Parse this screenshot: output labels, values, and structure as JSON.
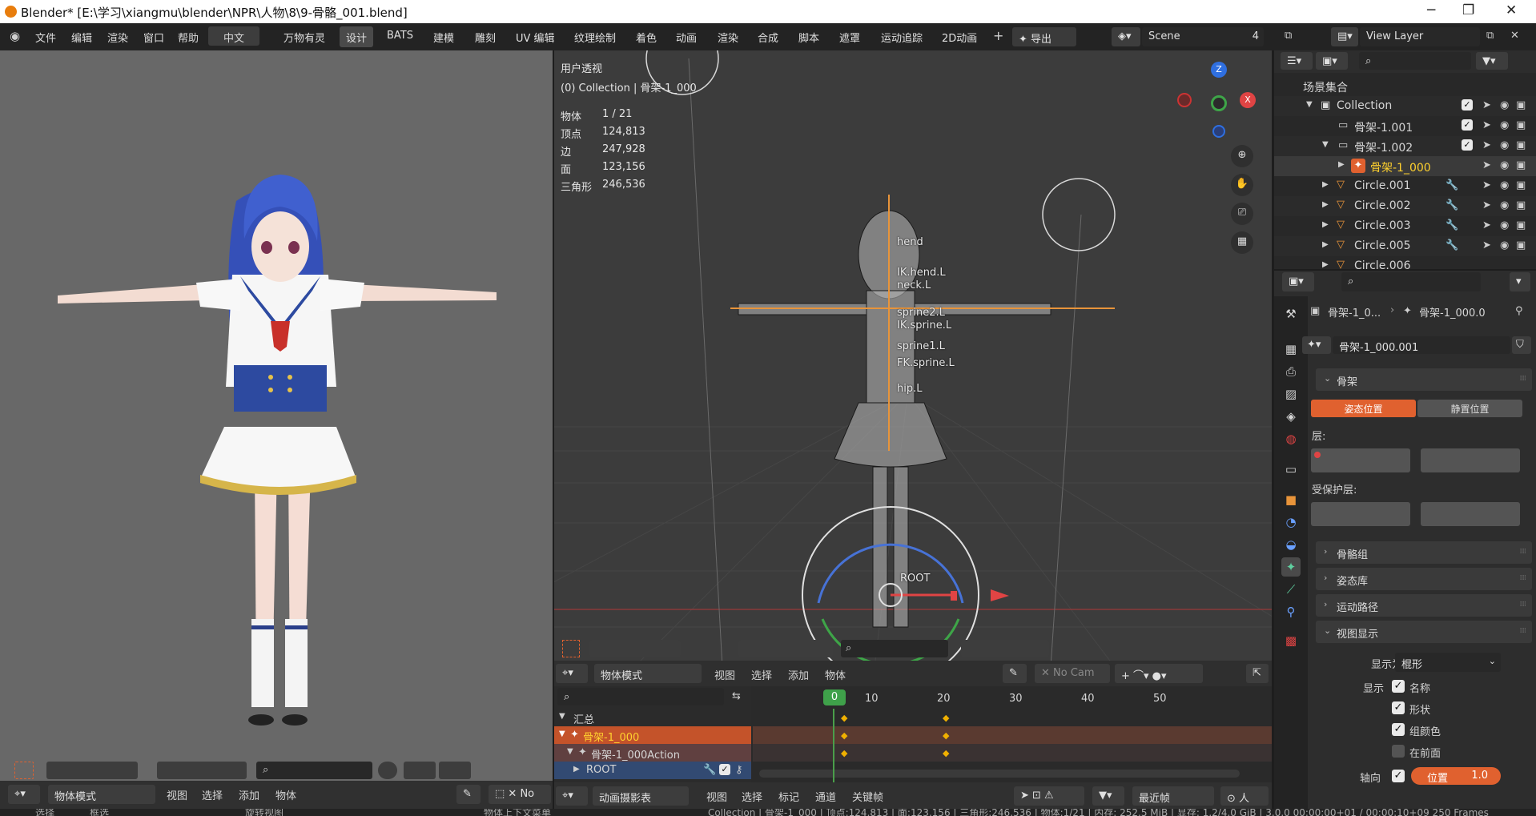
{
  "window": {
    "title": "Blender* [E:\\学习\\xiangmu\\blender\\NPR\\人物\\8\\9-骨骼_001.blend]"
  },
  "menus": [
    "文件",
    "编辑",
    "渲染",
    "窗口",
    "帮助"
  ],
  "language_button": "中文",
  "workspaces": [
    "万物有灵",
    "设计",
    "BATS",
    "建模",
    "雕刻",
    "UV 编辑",
    "纹理绘制",
    "着色",
    "动画",
    "渲染",
    "合成",
    "脚本",
    "遮罩",
    "运动追踪",
    "2D动画"
  ],
  "active_workspace": "设计",
  "export_label": "导出",
  "scene": {
    "name": "Scene",
    "num": "4"
  },
  "view_layer": "View Layer",
  "viewport": {
    "mode_label": "用户透视",
    "collection_info": "(0) Collection | 骨架-1_000",
    "stats": [
      {
        "k": "物体",
        "v": "1 / 21"
      },
      {
        "k": "顶点",
        "v": "124,813"
      },
      {
        "k": "边",
        "v": "247,928"
      },
      {
        "k": "面",
        "v": "123,156"
      },
      {
        "k": "三角形",
        "v": "246,536"
      }
    ],
    "gizmo": {
      "z": "Z",
      "x": "X"
    },
    "bones": [
      "hend",
      "IK.hend.L",
      "neck.L",
      "sprine2.L",
      "IK.sprine.L",
      "sprine1.L",
      "FK.sprine.L",
      "hip.L",
      "ROOT"
    ],
    "header": {
      "mode": "物体模式",
      "menus": [
        "视图",
        "选择",
        "添加",
        "物体"
      ],
      "camera": "No Cam"
    }
  },
  "left_view_header": {
    "mode": "物体模式",
    "menus": [
      "视图",
      "选择",
      "添加",
      "物体"
    ]
  },
  "outliner": {
    "root": "场景集合",
    "rows": [
      {
        "label": "Collection",
        "indent": 1
      },
      {
        "label": "骨架-1.001",
        "indent": 2
      },
      {
        "label": "骨架-1.002",
        "indent": 2
      },
      {
        "label": "骨架-1_000",
        "indent": 3
      },
      {
        "label": "Circle.001",
        "indent": 2
      },
      {
        "label": "Circle.002",
        "indent": 2
      },
      {
        "label": "Circle.003",
        "indent": 2
      },
      {
        "label": "Circle.005",
        "indent": 2
      },
      {
        "label": "Circle.006",
        "indent": 2
      }
    ]
  },
  "properties": {
    "breadcrumb_a": "骨架-1_0...",
    "breadcrumb_b": "骨架-1_000.0",
    "datablock": "骨架-1_000.001",
    "panel_skeleton": "骨架",
    "pose_position": "姿态位置",
    "rest_position": "静置位置",
    "layers_label": "层:",
    "protected_layers_label": "受保护层:",
    "bone_groups": "骨骼组",
    "pose_library": "姿态库",
    "motion_paths": "运动路径",
    "viewport_display": "视图显示",
    "display_as_label": "显示为",
    "display_as_value": "棍形",
    "show_label": "显示",
    "show_names": "名称",
    "show_shapes": "形状",
    "show_group_colors": "组颜色",
    "in_front": "在前面",
    "axes_label": "轴向",
    "position_label": "位置",
    "position_value": "1.0"
  },
  "timeline": {
    "frames": [
      "0",
      "10",
      "20",
      "30",
      "40",
      "50"
    ],
    "current_frame": "0",
    "rows": [
      "汇总",
      "骨架-1_000",
      "骨架-1_000Action",
      "ROOT"
    ],
    "header_mode": "动画摄影表",
    "header_menus": [
      "视图",
      "选择",
      "标记",
      "通道",
      "关键帧"
    ],
    "nearest_frame": "最近帧"
  },
  "status": {
    "left": [
      "选择",
      "框选",
      "旋转视图",
      "物体上下文菜单"
    ],
    "right": "Collection | 骨架-1_000 | 顶点:124,813 | 面:123,156 | 三角形:246,536 | 物体:1/21 | 内存: 252.5 MiB | 显存: 1.2/4.0 GiB | 3.0.0    00:00:00+01 / 00:00:10+09  250 Frames"
  },
  "colors": {
    "accent": "#e0612f",
    "select": "#ffd12e",
    "blue": "#4772b3",
    "bg": "#3c3c3c"
  }
}
